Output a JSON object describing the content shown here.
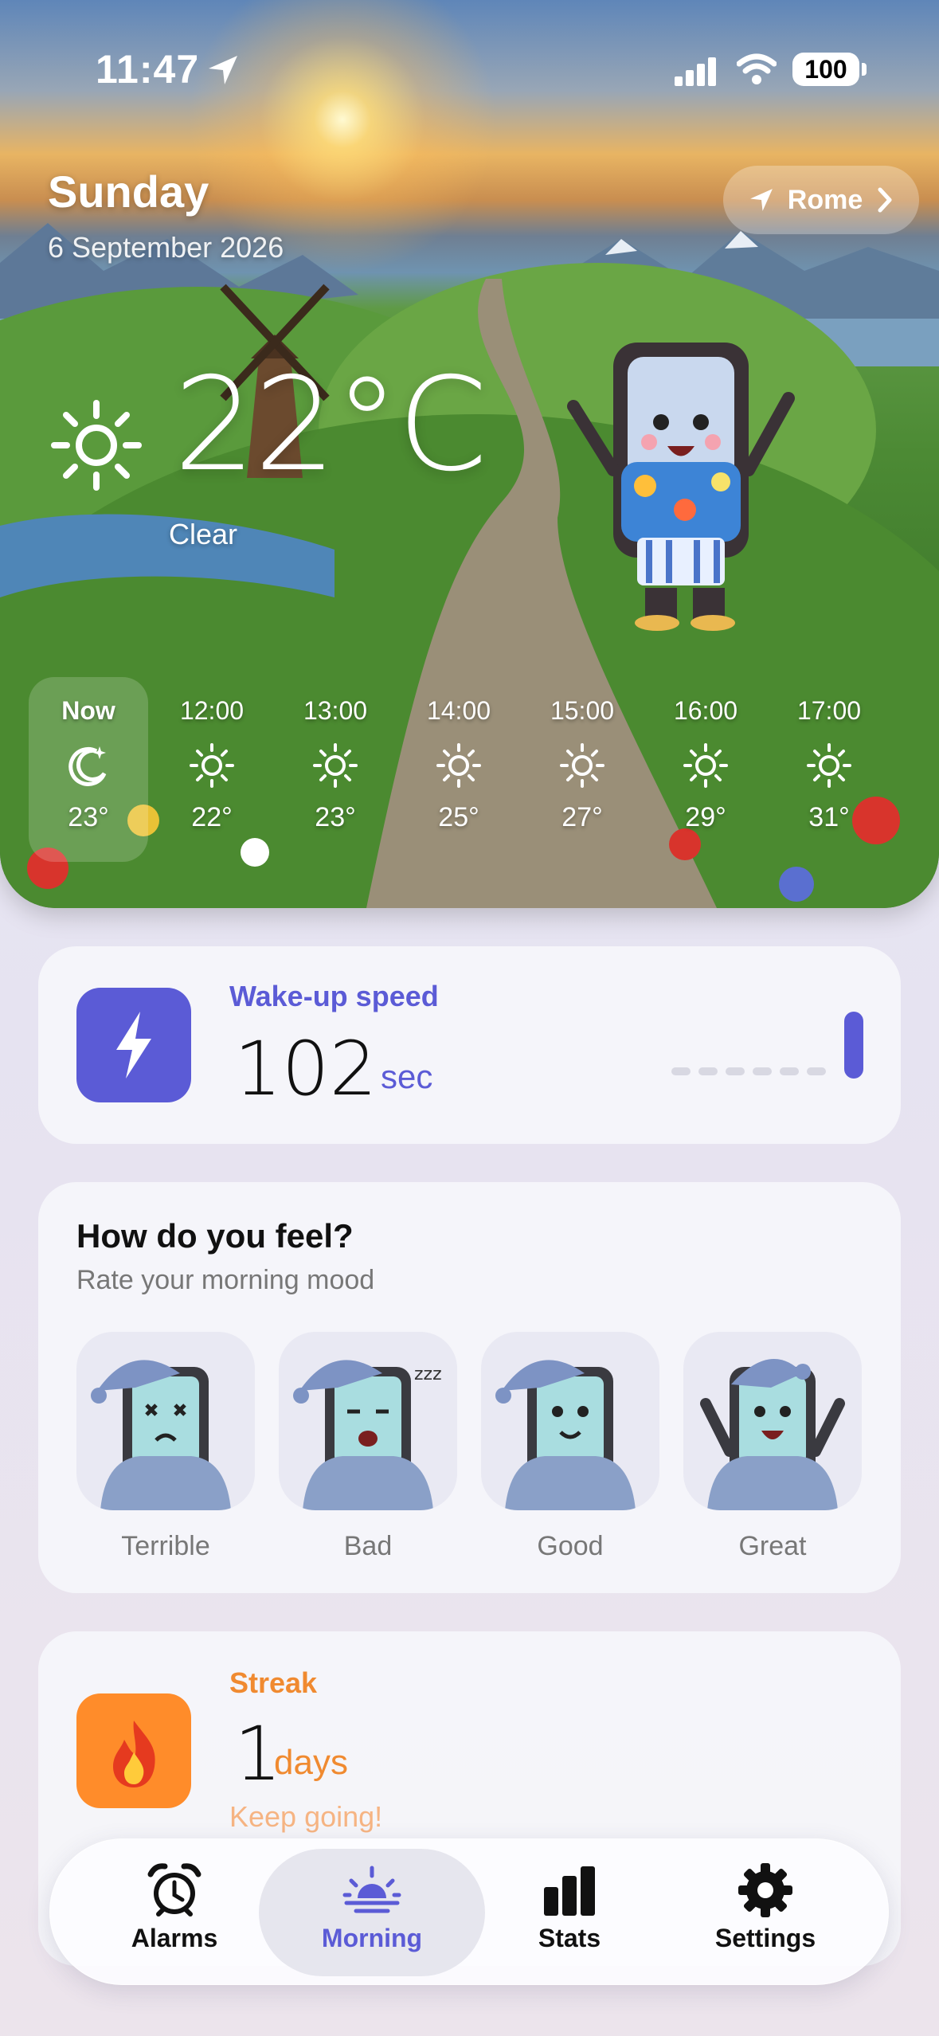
{
  "status_bar": {
    "time": "11:47",
    "battery": "100"
  },
  "header": {
    "day": "Sunday",
    "date": "6 September 2026",
    "location": "Rome"
  },
  "current": {
    "temp": "22°C",
    "condition": "Clear",
    "icon": "sun-icon"
  },
  "hourly": [
    {
      "label": "Now",
      "icon": "moon-stars-icon",
      "temp": "23°"
    },
    {
      "label": "12:00",
      "icon": "sun-icon",
      "temp": "22°"
    },
    {
      "label": "13:00",
      "icon": "sun-icon",
      "temp": "23°"
    },
    {
      "label": "14:00",
      "icon": "sun-icon",
      "temp": "25°"
    },
    {
      "label": "15:00",
      "icon": "sun-icon",
      "temp": "27°"
    },
    {
      "label": "16:00",
      "icon": "sun-icon",
      "temp": "29°"
    },
    {
      "label": "17:00",
      "icon": "sun-icon",
      "temp": "31°"
    }
  ],
  "wake_up": {
    "label": "Wake-up speed",
    "value": "102",
    "unit": "sec",
    "accent": "#5b5bd6"
  },
  "mood": {
    "title": "How do you feel?",
    "subtitle": "Rate your morning mood",
    "options": [
      {
        "label": "Terrible"
      },
      {
        "label": "Bad"
      },
      {
        "label": "Good"
      },
      {
        "label": "Great"
      }
    ]
  },
  "streak": {
    "label": "Streak",
    "value": "1",
    "unit": "days",
    "note": "Keep going!",
    "accent": "#f08a30"
  },
  "tabs": [
    {
      "label": "Alarms",
      "icon": "alarm-clock-icon"
    },
    {
      "label": "Morning",
      "icon": "sunrise-icon",
      "active": true
    },
    {
      "label": "Stats",
      "icon": "bar-chart-icon"
    },
    {
      "label": "Settings",
      "icon": "gear-icon"
    }
  ]
}
